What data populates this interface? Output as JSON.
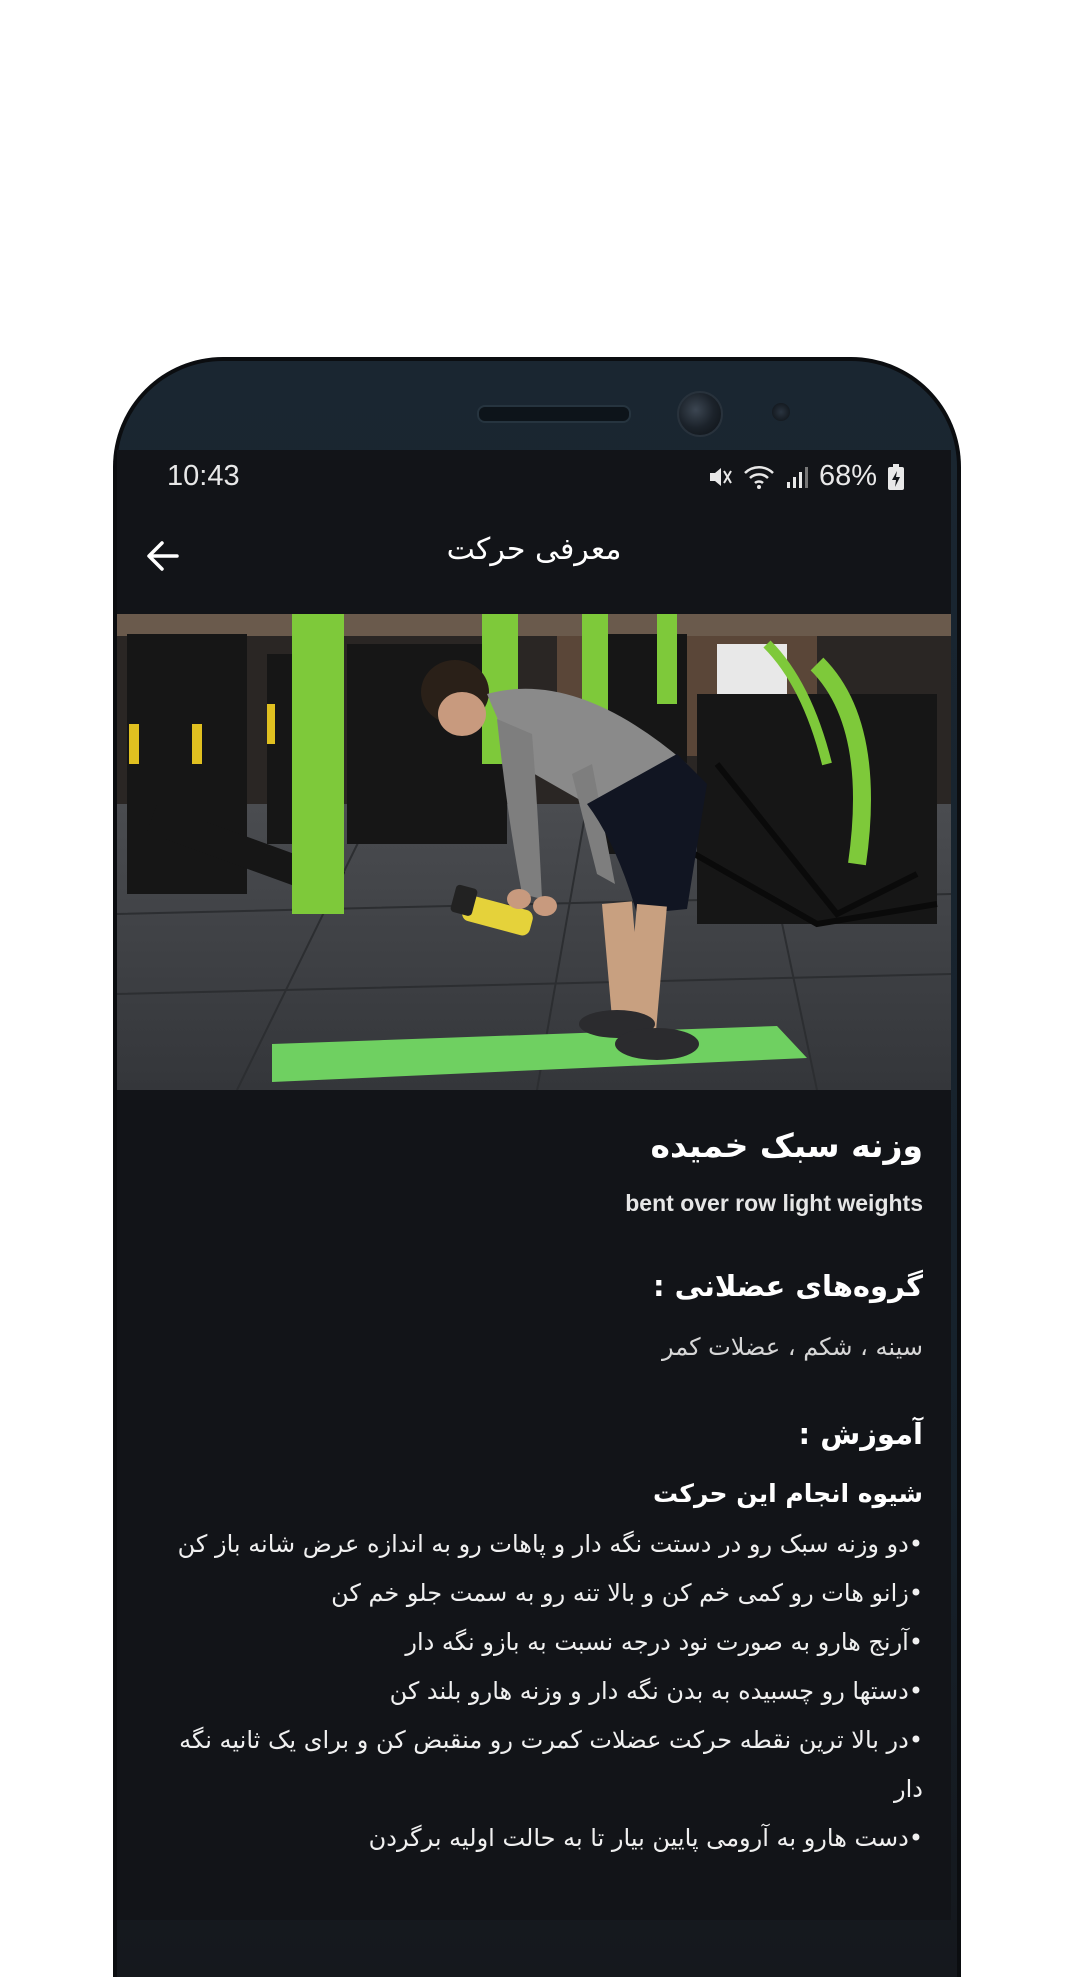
{
  "status_bar": {
    "time": "10:43",
    "battery": "68%",
    "icons": [
      "mute-icon",
      "wifi-icon",
      "signal-icon",
      "battery-charging-icon"
    ]
  },
  "app_bar": {
    "title": "معرفی حرکت",
    "back_icon": "arrow-left-icon"
  },
  "exercise": {
    "title": "وزنه سبک خمیده",
    "latin_name": "bent over row light weights",
    "muscle_groups_heading": "گروه‌های عضلانی :",
    "muscle_groups": "سینه ، شکم ، عضلات کمر",
    "training_heading": "آموزش :",
    "method_heading": "شیوه انجام این حرکت",
    "steps": [
      "•دو وزنه سبک رو در دستت نگه دار و پاهات رو به اندازه عرض شانه باز کن",
      "•زانو هات رو کمی خم کن و بالا تنه رو به سمت جلو خم کن",
      "•آرنج هارو به صورت نود درجه نسبت به بازو نگه دار",
      "•دستها رو چسبیده به بدن نگه دار و وزنه هارو بلند کن",
      "•در بالا ترین نقطه حرکت عضلات کمرت رو منقبض کن و برای یک ثانیه نگه دار",
      "•دست هارو به آرومی پایین بیار تا به حالت اولیه برگردن"
    ]
  },
  "colors": {
    "screen_bg": "#121418",
    "text": "#ffffff",
    "mat_green": "#6fd061",
    "pillar_green": "#7ec93a"
  }
}
